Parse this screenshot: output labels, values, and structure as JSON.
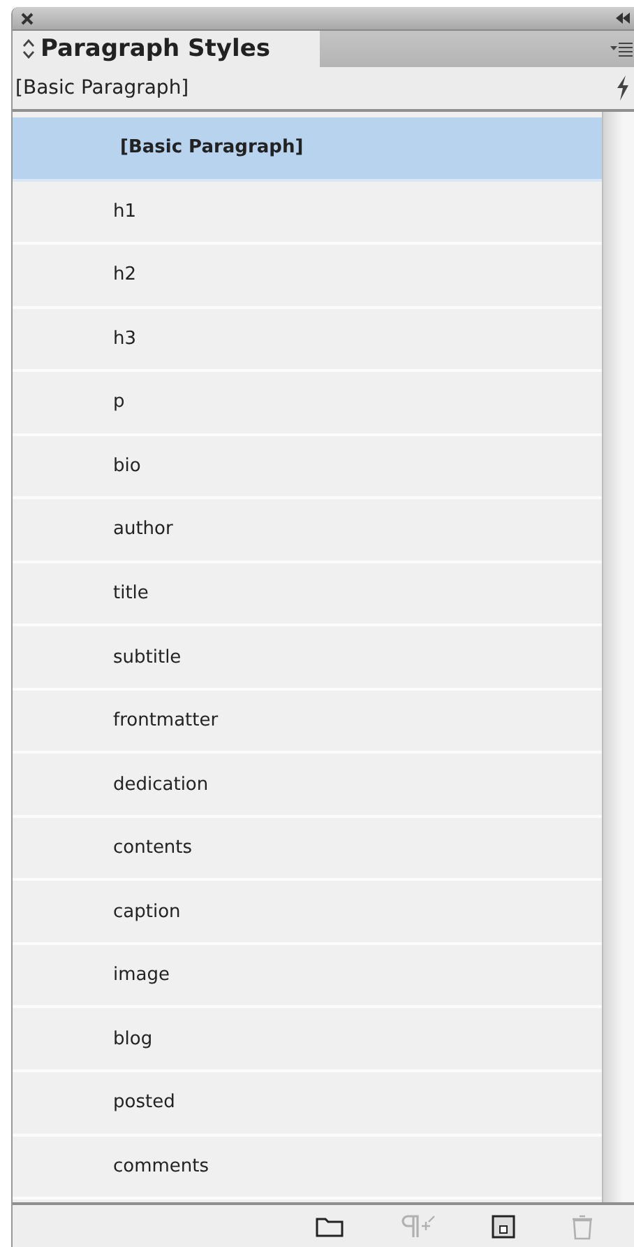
{
  "panel": {
    "title": "Paragraph Styles",
    "current_style": "[Basic Paragraph]"
  },
  "styles": [
    {
      "label": "[Basic Paragraph]",
      "selected": true
    },
    {
      "label": "h1",
      "selected": false
    },
    {
      "label": "h2",
      "selected": false
    },
    {
      "label": "h3",
      "selected": false
    },
    {
      "label": "p",
      "selected": false
    },
    {
      "label": "bio",
      "selected": false
    },
    {
      "label": "author",
      "selected": false
    },
    {
      "label": "title",
      "selected": false
    },
    {
      "label": "subtitle",
      "selected": false
    },
    {
      "label": "frontmatter",
      "selected": false
    },
    {
      "label": "dedication",
      "selected": false
    },
    {
      "label": "contents",
      "selected": false
    },
    {
      "label": "caption",
      "selected": false
    },
    {
      "label": "image",
      "selected": false
    },
    {
      "label": "blog",
      "selected": false
    },
    {
      "label": "posted",
      "selected": false
    },
    {
      "label": "comments",
      "selected": false
    }
  ],
  "footer_buttons": [
    {
      "kind": "folder",
      "disabled": false
    },
    {
      "kind": "clear",
      "disabled": true
    },
    {
      "kind": "new",
      "disabled": false
    },
    {
      "kind": "trash",
      "disabled": true
    }
  ]
}
